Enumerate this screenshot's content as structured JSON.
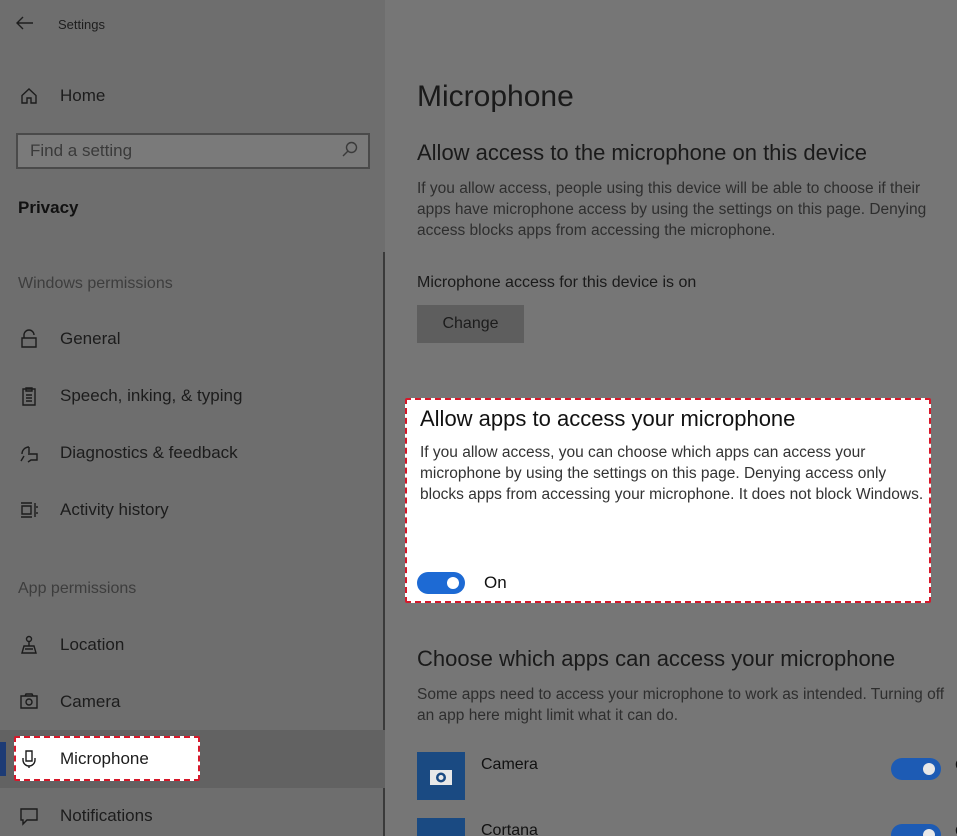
{
  "window": {
    "title": "Settings",
    "back_icon": "back-arrow-icon"
  },
  "sidebar": {
    "home_label": "Home",
    "search_placeholder": "Find a setting",
    "section": "Privacy",
    "windows_permissions_label": "Windows permissions",
    "windows_items": [
      {
        "label": "General",
        "icon": "lock-icon"
      },
      {
        "label": "Speech, inking, & typing",
        "icon": "clipboard-icon"
      },
      {
        "label": "Diagnostics & feedback",
        "icon": "feedback-icon"
      },
      {
        "label": "Activity history",
        "icon": "timeline-icon"
      }
    ],
    "app_permissions_label": "App permissions",
    "app_items": [
      {
        "label": "Location",
        "icon": "location-icon"
      },
      {
        "label": "Camera",
        "icon": "camera-icon"
      },
      {
        "label": "Microphone",
        "icon": "microphone-icon",
        "selected": true
      },
      {
        "label": "Notifications",
        "icon": "notifications-icon"
      }
    ]
  },
  "main": {
    "title": "Microphone",
    "device_section": {
      "heading": "Allow access to the microphone on this device",
      "description": "If you allow access, people using this device will be able to choose if their apps have microphone access by using the settings on this page. Denying access blocks apps from accessing the microphone.",
      "status": "Microphone access for this device is on",
      "change_button": "Change"
    },
    "apps_section": {
      "heading": "Allow apps to access your microphone",
      "description": "If you allow access, you can choose which apps can access your microphone by using the settings on this page. Denying access only blocks apps from accessing your microphone. It does not block Windows.",
      "toggle_state": "On",
      "toggle_on": true
    },
    "choose_section": {
      "heading": "Choose which apps can access your microphone",
      "description": "Some apps need to access your microphone to work as intended. Turning off an app here might limit what it can do.",
      "apps": [
        {
          "name": "Camera",
          "state": "On",
          "on": true
        },
        {
          "name": "Cortana",
          "state": "On",
          "on": true
        }
      ]
    }
  },
  "colors": {
    "accent": "#1d6ad4",
    "highlight_border": "#d6192b",
    "dim_overlay": "#757575"
  }
}
